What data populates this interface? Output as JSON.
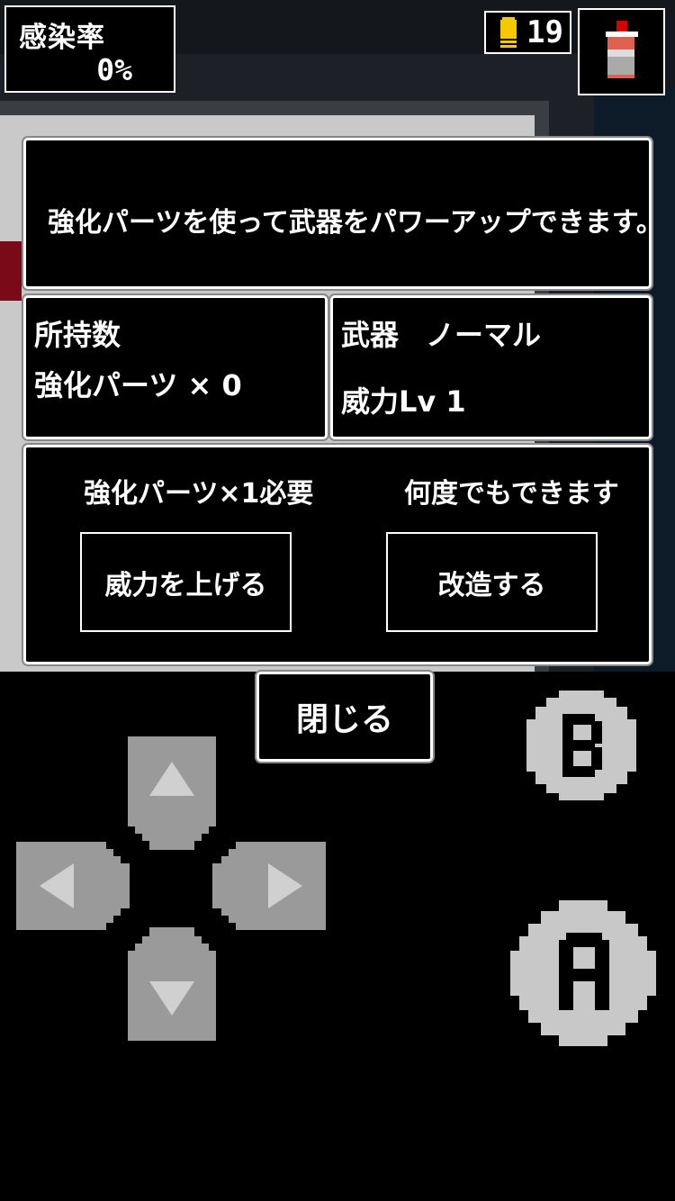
{
  "hud": {
    "infection_label": "感染率",
    "infection_value": "0%",
    "ammo_count": "19",
    "ammo_icon": "bullet-icon",
    "item_icon": "spray-can-icon"
  },
  "message": "強化パーツを使って武器をパワーアップできます。",
  "owned": {
    "title": "所持数",
    "parts": "強化パーツ × 0"
  },
  "weapon": {
    "label": "武器",
    "name": "ノーマル",
    "power": "威力Lv 1"
  },
  "actions": {
    "power_req": "強化パーツ×1必要",
    "power_button": "威力を上げる",
    "modify_req": "何度でもできます",
    "modify_button": "改造する"
  },
  "close_button": "閉じる",
  "controls": {
    "b_button": "B",
    "a_button": "A"
  },
  "colors": {
    "bullet": "#f5c800",
    "pad": "#9a9a9a",
    "ab_button": "#c8c8c8",
    "spray_cap": "#d80000"
  }
}
